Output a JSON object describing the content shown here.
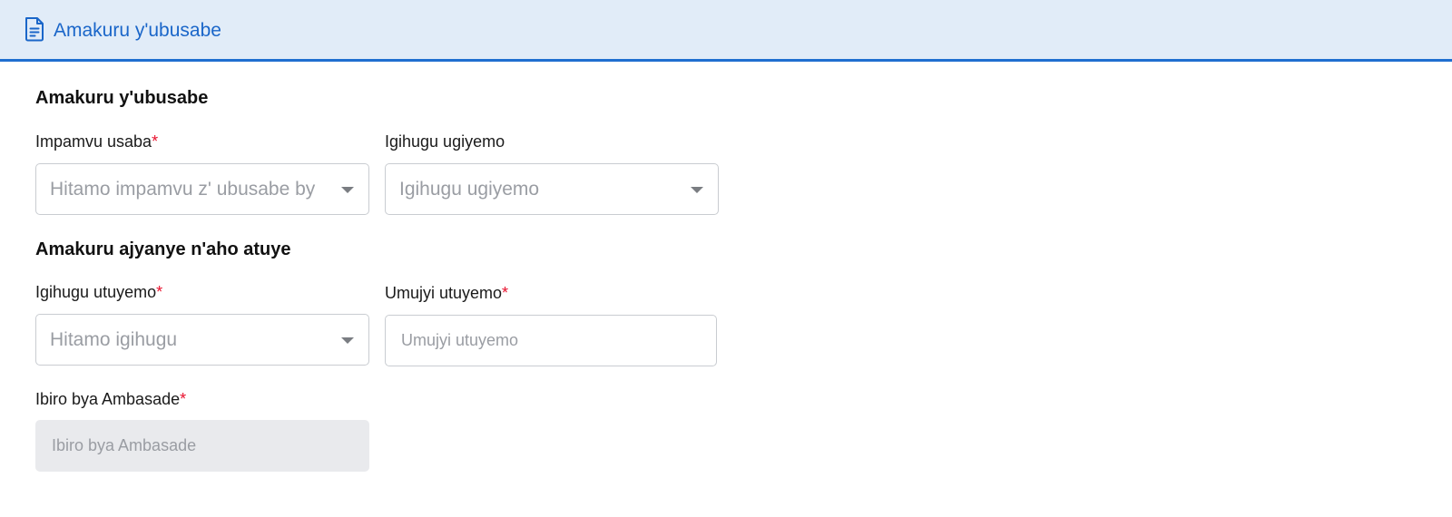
{
  "header": {
    "icon": "document-icon",
    "title": "Amakuru y'ubusabe",
    "accent_color": "#1f6fd0"
  },
  "sections": {
    "application_info": {
      "title": "Amakuru y'ubusabe",
      "reason_field": {
        "label": "Impamvu usaba",
        "required_mark": "*",
        "placeholder": "Hitamo impamvu z' ubusabe by"
      },
      "destination_field": {
        "label": "Igihugu ugiyemo",
        "placeholder": "Igihugu ugiyemo"
      }
    },
    "residence_info": {
      "title": "Amakuru ajyanye n'aho atuye",
      "country_field": {
        "label": "Igihugu utuyemo",
        "required_mark": "*",
        "placeholder": "Hitamo igihugu"
      },
      "city_field": {
        "label": "Umujyi utuyemo",
        "required_mark": "*",
        "placeholder": "Umujyi utuyemo"
      },
      "embassy_field": {
        "label": "Ibiro bya Ambasade",
        "required_mark": "*",
        "placeholder": "Ibiro bya Ambasade"
      }
    }
  }
}
